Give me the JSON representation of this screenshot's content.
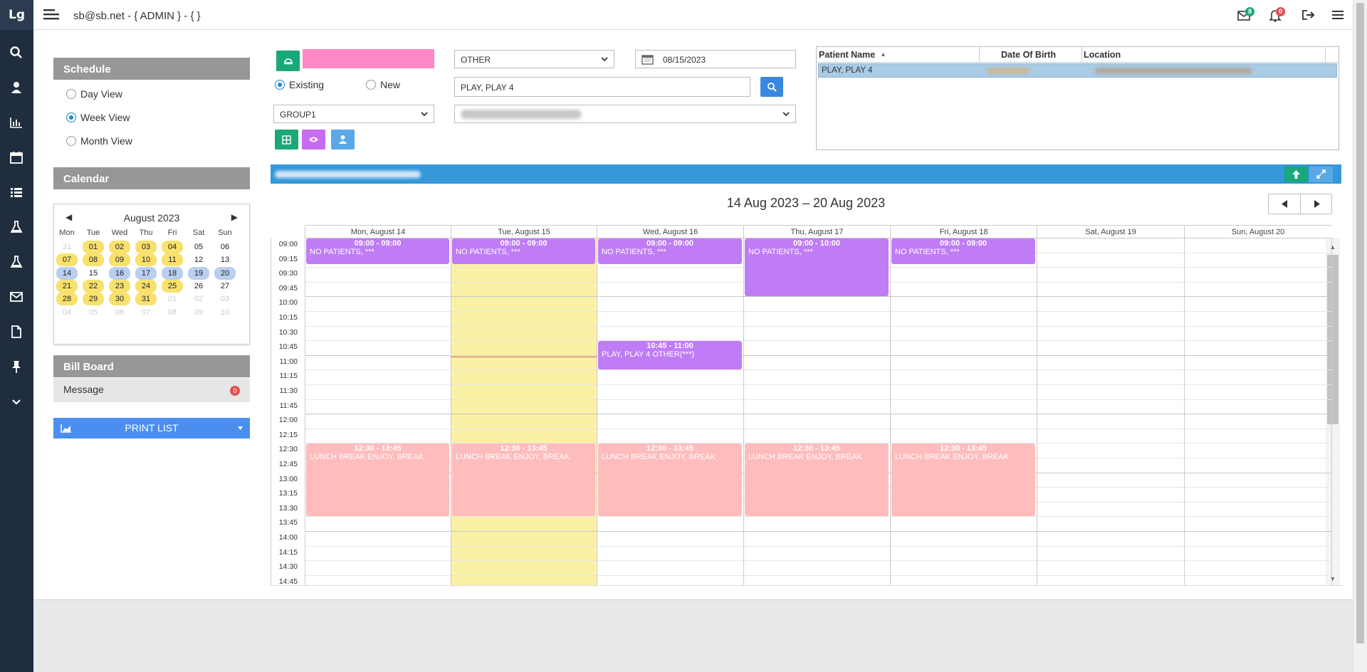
{
  "sidebar": {
    "logo": "Lg",
    "icons": [
      "search-icon",
      "user-icon",
      "chart-icon",
      "calendar-icon",
      "list-icon",
      "flask-icon",
      "flask-icon",
      "mail-icon",
      "document-icon",
      "pin-icon",
      "chevron-down-icon"
    ]
  },
  "header": {
    "title": "sb@sb.net - { ADMIN } - { }",
    "mail_count": "8",
    "bell_count": "0"
  },
  "schedule": {
    "heading": "Schedule",
    "views": [
      {
        "label": "Day View",
        "selected": false
      },
      {
        "label": "Week View",
        "selected": true
      },
      {
        "label": "Month View",
        "selected": false
      }
    ]
  },
  "calendar_panel": {
    "heading": "Calendar",
    "month": "August 2023",
    "weekdays": [
      "Mon",
      "Tue",
      "Wed",
      "Thu",
      "Fri",
      "Sat",
      "Sun"
    ],
    "weeks": [
      [
        {
          "d": "31",
          "s": "g"
        },
        {
          "d": "01",
          "s": "y"
        },
        {
          "d": "02",
          "s": "y"
        },
        {
          "d": "03",
          "s": "y"
        },
        {
          "d": "04",
          "s": "y"
        },
        {
          "d": "05",
          "s": ""
        },
        {
          "d": "06",
          "s": ""
        }
      ],
      [
        {
          "d": "07",
          "s": "y"
        },
        {
          "d": "08",
          "s": "y"
        },
        {
          "d": "09",
          "s": "y"
        },
        {
          "d": "10",
          "s": "y"
        },
        {
          "d": "11",
          "s": "y"
        },
        {
          "d": "12",
          "s": ""
        },
        {
          "d": "13",
          "s": ""
        }
      ],
      [
        {
          "d": "14",
          "s": "b"
        },
        {
          "d": "15",
          "s": ""
        },
        {
          "d": "16",
          "s": "b"
        },
        {
          "d": "17",
          "s": "b"
        },
        {
          "d": "18",
          "s": "b"
        },
        {
          "d": "19",
          "s": "b"
        },
        {
          "d": "20",
          "s": "b"
        }
      ],
      [
        {
          "d": "21",
          "s": "y"
        },
        {
          "d": "22",
          "s": "y"
        },
        {
          "d": "23",
          "s": "y"
        },
        {
          "d": "24",
          "s": "y"
        },
        {
          "d": "25",
          "s": "y"
        },
        {
          "d": "26",
          "s": ""
        },
        {
          "d": "27",
          "s": ""
        }
      ],
      [
        {
          "d": "28",
          "s": "y"
        },
        {
          "d": "29",
          "s": "y"
        },
        {
          "d": "30",
          "s": "y"
        },
        {
          "d": "31",
          "s": "y"
        },
        {
          "d": "01",
          "s": "g"
        },
        {
          "d": "02",
          "s": "g"
        },
        {
          "d": "03",
          "s": "g"
        }
      ],
      [
        {
          "d": "04",
          "s": "g"
        },
        {
          "d": "05",
          "s": "g"
        },
        {
          "d": "06",
          "s": "g"
        },
        {
          "d": "07",
          "s": "g"
        },
        {
          "d": "08",
          "s": "g"
        },
        {
          "d": "09",
          "s": "g"
        },
        {
          "d": "10",
          "s": "g"
        }
      ]
    ]
  },
  "billboard": {
    "heading": "Bill Board",
    "message_label": "Message",
    "message_count": "0"
  },
  "print_list": {
    "label": "PRINT LIST"
  },
  "form": {
    "existing_label": "Existing",
    "new_label": "New",
    "group_value": "GROUP1",
    "type_value": "OTHER",
    "date_value": "08/15/2023",
    "patient_value": "PLAY, PLAY 4"
  },
  "patient_table": {
    "headers": [
      "Patient Name",
      "Date Of Birth",
      "Location"
    ],
    "rows": [
      {
        "name": "PLAY, PLAY 4"
      }
    ]
  },
  "week": {
    "range": "14 Aug 2023 – 20 Aug 2023",
    "days": [
      "Mon, August 14",
      "Tue, August 15",
      "Wed, August 16",
      "Thu, August 17",
      "Fri, August 18",
      "Sat, August 19",
      "Sun, August 20"
    ],
    "times": [
      "09:00",
      "09:15",
      "09:30",
      "09:45",
      "10:00",
      "10:15",
      "10:30",
      "10:45",
      "11:00",
      "11:15",
      "11:30",
      "11:45",
      "12:00",
      "12:15",
      "12:30",
      "12:45",
      "13:00",
      "13:15",
      "13:30",
      "13:45",
      "14:00",
      "14:15",
      "14:30",
      "14:45"
    ],
    "events": [
      {
        "day": 0,
        "start": 0,
        "end": 0.9,
        "time": "09:00 - 09:00",
        "text": "NO PATIENTS, ***",
        "kind": "p"
      },
      {
        "day": 1,
        "start": 0,
        "end": 0.9,
        "time": "09:00 - 09:00",
        "text": "NO PATIENTS, ***",
        "kind": "p"
      },
      {
        "day": 2,
        "start": 0,
        "end": 0.9,
        "time": "09:00 - 09:00",
        "text": "NO PATIENTS, ***",
        "kind": "p"
      },
      {
        "day": 3,
        "start": 0,
        "end": 4,
        "time": "09:00 - 10:00",
        "text": "NO PATIENTS, ***",
        "kind": "p"
      },
      {
        "day": 4,
        "start": 0,
        "end": 0.9,
        "time": "09:00 - 09:00",
        "text": "NO PATIENTS, ***",
        "kind": "p"
      },
      {
        "day": 2,
        "start": 7,
        "end": 9,
        "time": "10:45 - 11:00",
        "text": "PLAY, PLAY 4 OTHER(***)",
        "kind": "p"
      },
      {
        "day": 0,
        "start": 14,
        "end": 19,
        "time": "12:30 - 13:45",
        "text": "LUNCH BREAK ENJOY, BREAK",
        "kind": "r"
      },
      {
        "day": 1,
        "start": 14,
        "end": 19,
        "time": "12:30 - 13:45",
        "text": "LUNCH BREAK ENJOY, BREAK",
        "kind": "r"
      },
      {
        "day": 2,
        "start": 14,
        "end": 19,
        "time": "12:30 - 13:45",
        "text": "LUNCH BREAK ENJOY, BREAK",
        "kind": "r"
      },
      {
        "day": 3,
        "start": 14,
        "end": 19,
        "time": "12:30 - 13:45",
        "text": "LUNCH BREAK ENJOY, BREAK",
        "kind": "r"
      },
      {
        "day": 4,
        "start": 14,
        "end": 19,
        "time": "12:30 - 13:45",
        "text": "LUNCH BREAK ENJOY, BREAK",
        "kind": "r"
      }
    ]
  },
  "colors": {
    "sidebar": "#1f2d3f",
    "accent_blue": "#3498db",
    "event_purple": "#c07cf5",
    "event_break": "#ffbcbc",
    "today_column": "#fbf1a4",
    "green_button": "#1aa77a",
    "pink_field": "#ff88c6"
  }
}
